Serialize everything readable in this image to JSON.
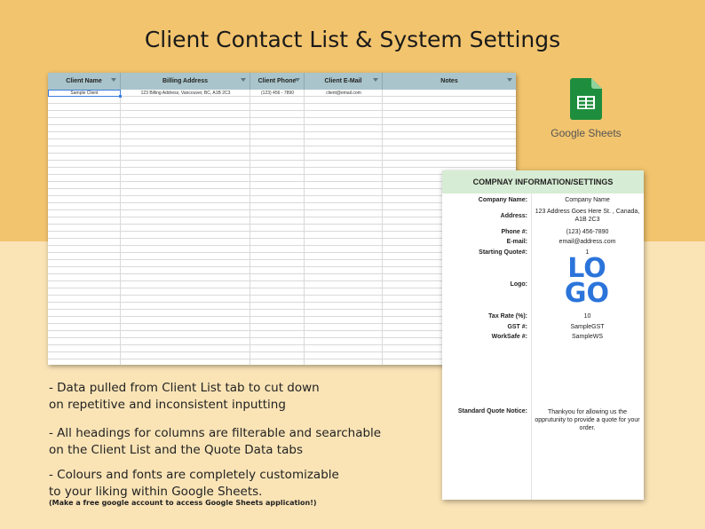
{
  "title": "Client Contact List & System Settings",
  "sheet": {
    "columns": [
      "Client Name",
      "Billing Address",
      "Client Phone",
      "Client E-Mail",
      "Notes"
    ],
    "rows": [
      [
        "Sample Client",
        "123 Billing Address, Vancouver, BC, A1B 2C3",
        "(123) 456 - 7890",
        "client@email.com",
        ""
      ]
    ]
  },
  "app_logo": {
    "icon": "google-sheets-icon",
    "label": "Google Sheets",
    "color": "#1e8e3e"
  },
  "settings": {
    "title": "COMPNAY INFORMATION/SETTINGS",
    "rows": [
      {
        "label": "Company Name:",
        "value": "Company Name"
      },
      {
        "label": "Address:",
        "value": "123 Address Goes Here St. , Canada, A1B 2C3"
      },
      {
        "label": "Phone #:",
        "value": "(123) 456-7890"
      },
      {
        "label": "E-mail:",
        "value": "email@address.com"
      },
      {
        "label": "Starting Quote#:",
        "value": "1"
      },
      {
        "label": "Logo:",
        "value": ""
      },
      {
        "label": "Tax Rate (%):",
        "value": "10"
      },
      {
        "label": "GST #:",
        "value": "SampleGST"
      },
      {
        "label": "WorkSafe #:",
        "value": "SampleWS"
      },
      {
        "label": "Standard Quote Notice:",
        "value": "Thankyou for allowing us the opprutunity to provide a quote for your order."
      }
    ],
    "logo_text_top": "LO",
    "logo_text_bottom": "GO",
    "logo_color": "#2b74db"
  },
  "notes": [
    {
      "line1": "- Data pulled from Client List tab to cut down",
      "line2": "on repetitive and inconsistent inputting"
    },
    {
      "line1": "- All headings for columns are filterable and searchable",
      "line2": "on the Client List and the Quote Data tabs"
    },
    {
      "line1": "- Colours and fonts are completely customizable",
      "line2": "to your liking within Google Sheets."
    }
  ],
  "footnote": "(Make a free google account to access Google Sheets application!)"
}
